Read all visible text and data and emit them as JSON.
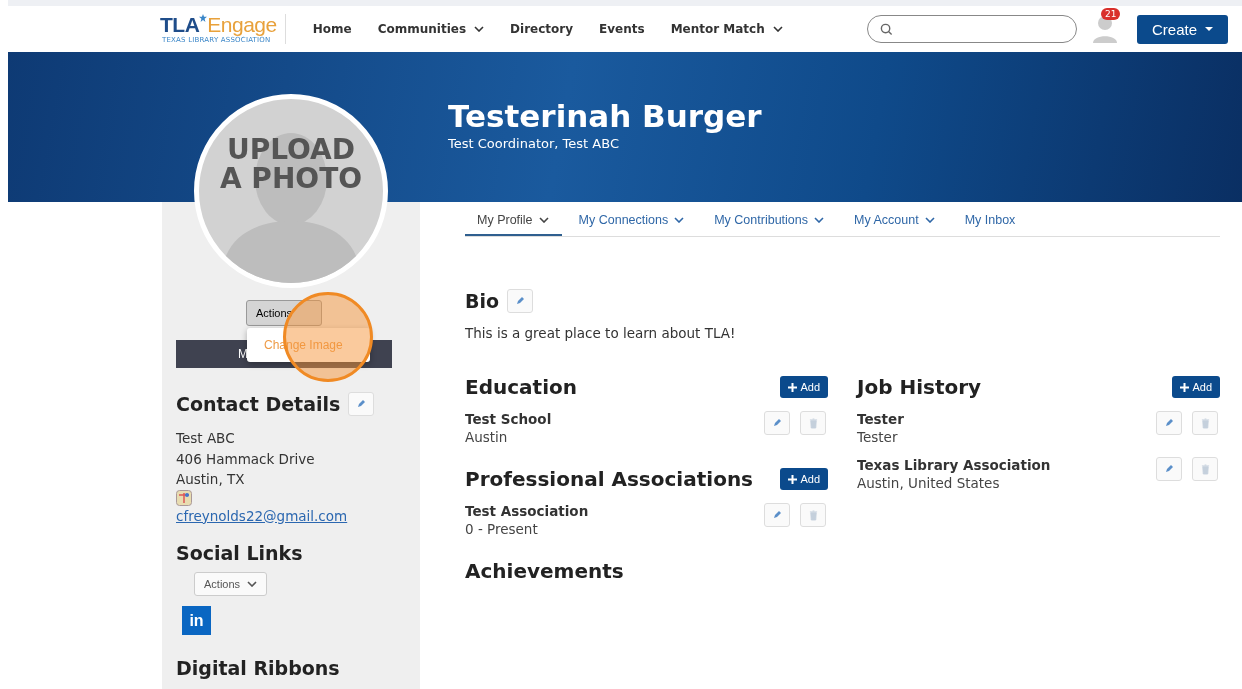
{
  "header": {
    "logo": {
      "primary": "TLA",
      "secondary": "Engage",
      "tagline": "TEXAS LIBRARY ASSOCIATION"
    },
    "nav": [
      {
        "label": "Home",
        "dropdown": false
      },
      {
        "label": "Communities",
        "dropdown": true
      },
      {
        "label": "Directory",
        "dropdown": false
      },
      {
        "label": "Events",
        "dropdown": false
      },
      {
        "label": "Mentor Match",
        "dropdown": true
      }
    ],
    "notification_count": "21",
    "create_button": "Create"
  },
  "profile": {
    "name": "Testerinah Burger",
    "title": "Test Coordinator, Test ABC",
    "photo_text": "UPLOAD A PHOTO"
  },
  "sidebar": {
    "actions_button": "Actions",
    "actions_menu": [
      {
        "label": "Change Image"
      }
    ],
    "covered_button": "M",
    "contact": {
      "title": "Contact Details",
      "lines": [
        "Test ABC",
        "406 Hammack Drive",
        "Austin, TX"
      ],
      "email": "cfreynolds22@gmail.com"
    },
    "social": {
      "title": "Social Links",
      "actions_button": "Actions",
      "links": [
        {
          "label": "in"
        }
      ]
    },
    "ribbons_title": "Digital Ribbons"
  },
  "tabs": [
    {
      "label": "My Profile",
      "dropdown": true,
      "selected": true
    },
    {
      "label": "My Connections",
      "dropdown": true,
      "selected": false
    },
    {
      "label": "My Contributions",
      "dropdown": true,
      "selected": false
    },
    {
      "label": "My Account",
      "dropdown": true,
      "selected": false
    },
    {
      "label": "My Inbox",
      "dropdown": false,
      "selected": false
    }
  ],
  "bio": {
    "title": "Bio",
    "text": "This is a great place to learn about TLA!"
  },
  "columns": [
    [
      {
        "title": "Education",
        "add_button": "Add",
        "items": [
          {
            "title": "Test School",
            "subtitle": "Austin"
          }
        ]
      },
      {
        "title": "Professional Associations",
        "add_button": "Add",
        "items": [
          {
            "title": "Test Association",
            "subtitle": "0 - Present"
          }
        ]
      },
      {
        "title": "Achievements"
      }
    ],
    [
      {
        "title": "Job History",
        "add_button": "Add",
        "items": [
          {
            "title": "Tester",
            "subtitle": "Tester"
          },
          {
            "title": "Texas Library Association",
            "subtitle": "Austin, United States"
          }
        ]
      }
    ]
  ]
}
